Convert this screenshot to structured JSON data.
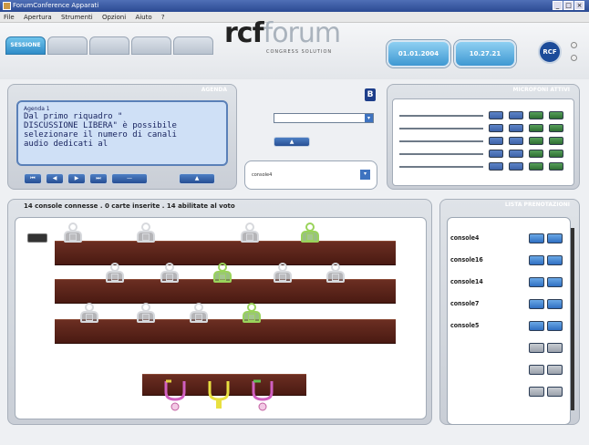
{
  "window": {
    "title": "ForumConference Apparati"
  },
  "menu": [
    "File",
    "Apertura",
    "Strumenti",
    "Opzioni",
    "Aiuto",
    "?"
  ],
  "tabs": [
    "SESSIONE",
    "",
    "",
    "",
    ""
  ],
  "logo": {
    "main": "rcf",
    "accent": "forum",
    "subtitle": "CONGRESS SOLUTION"
  },
  "header_buttons": [
    {
      "id": "date",
      "label": "01.01.2004"
    },
    {
      "id": "time",
      "label": "10.27.21"
    }
  ],
  "brand_badge": "RCF",
  "agenda": {
    "panel_title": "AGENDA",
    "item_label": "Agenda 1",
    "text_lines": [
      "Dal primo riquadro \"",
      "DISCUSSIONE LIBERA\" è possibile",
      "selezionare il numero di canali",
      "audio dedicati al"
    ],
    "controls": [
      "",
      "",
      "",
      "",
      "",
      ""
    ]
  },
  "middle": {
    "dropdown1": "",
    "dropdown2": "",
    "dropdown3": "console4",
    "indicator": "B"
  },
  "mic_panel": {
    "title": "MICROFONI ATTIVI",
    "rows": 5
  },
  "seating": {
    "header": "14 console connesse . 0 carte inserite . 14 abilitate al voto",
    "panel_title": "",
    "rows": [
      [
        "grey",
        "grey",
        "grey",
        "green"
      ],
      [
        "grey",
        "grey",
        "green",
        "grey",
        "grey"
      ],
      [
        "grey",
        "grey",
        "grey",
        "green"
      ]
    ]
  },
  "queue": {
    "title": "LISTA PRENOTAZIONI",
    "items": [
      "console4",
      "console16",
      "console14",
      "console7",
      "console5"
    ],
    "empty_slots": 3
  },
  "colors": {
    "accent": "#3e98d2",
    "desk": "#5b2418",
    "active_seat": "#9ad35b",
    "text_panel": "#cfe0f6"
  }
}
